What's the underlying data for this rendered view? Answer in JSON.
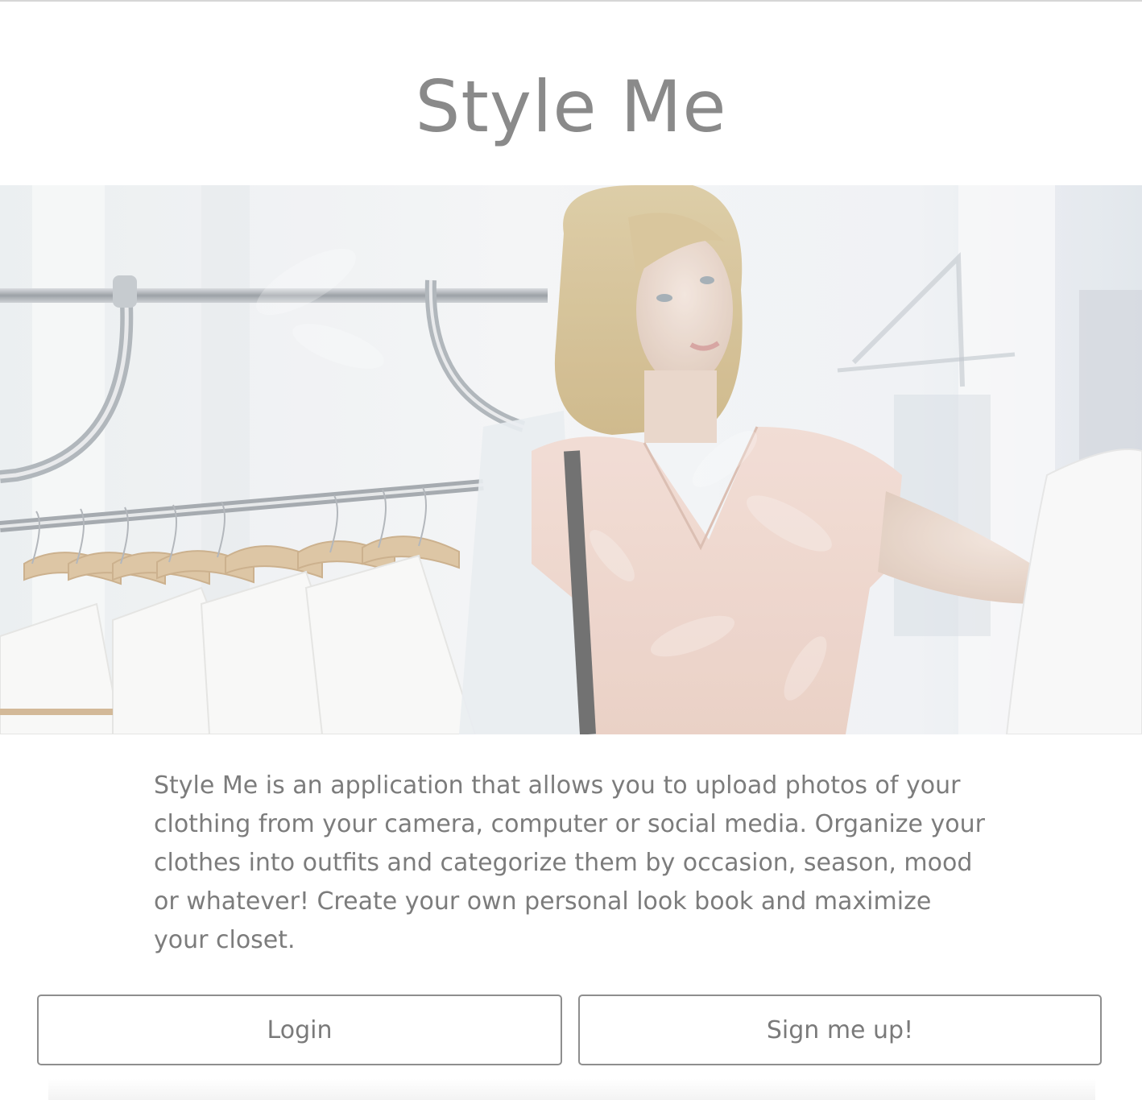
{
  "header": {
    "title": "Style Me"
  },
  "hero": {
    "image": "woman-browsing-clothing-rack-photo"
  },
  "main": {
    "description": "Style Me is an application that allows you to upload photos of your clothing from your camera, computer or social media. Organize your clothes into outfits and categorize them by occasion, season, mood or whatever! Create your own personal look book and maximize your closet."
  },
  "actions": {
    "login_label": "Login",
    "signup_label": "Sign me up!"
  },
  "colors": {
    "text": "#8a8a8a",
    "button_border": "#8e8e8e",
    "background": "#ffffff"
  }
}
